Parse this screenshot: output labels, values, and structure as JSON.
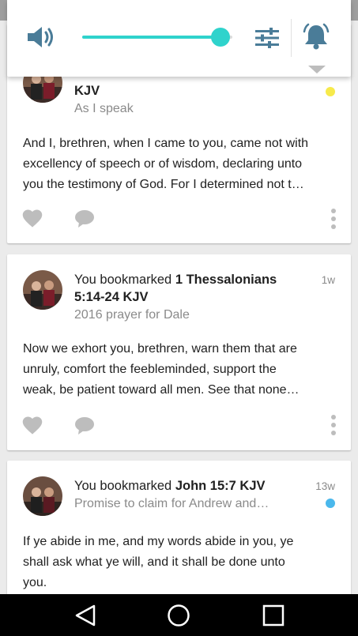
{
  "colors": {
    "accent": "#2fd3cc",
    "unread_yellow": "#f7ea4b",
    "unread_blue": "#4ab8ec",
    "icon_gray": "#bdbdbd",
    "popup_icon": "#4a7c98"
  },
  "volume_popup": {
    "volume_icon": "speaker-icon",
    "level": 0.92,
    "settings_icon": "equalizer-icon",
    "alert_icon": "bell-icon",
    "expand_icon": "chevron-down-icon"
  },
  "feed": [
    {
      "reference": "KJV",
      "note": "As I speak",
      "unread_color": "yellow",
      "body_lines": [
        "And I, brethren, when I came to you, came not with",
        "excellency of speech or of wisdom, declaring unto",
        "you the testimony of God.  For I determined not t…"
      ]
    },
    {
      "prefix": "You bookmarked ",
      "reference_line1": "1 Thessalonians",
      "reference_line2": "5:14-24 KJV",
      "time": "1w",
      "note": "2016 prayer for Dale",
      "body_lines": [
        "Now we exhort you, brethren, warn them that are",
        "unruly, comfort the feebleminded, support the",
        "weak, be patient toward all men.  See that none…"
      ]
    },
    {
      "prefix": "You bookmarked ",
      "reference": "John 15:7 KJV",
      "time": "13w",
      "note": "Promise to claim for Andrew and…",
      "unread_color": "blue",
      "body_lines": [
        "If ye abide in me, and my words abide in you, ye",
        "shall ask what ye will, and it shall be done unto",
        "you."
      ]
    }
  ],
  "actions": {
    "like_icon": "heart-icon",
    "comment_icon": "comment-icon",
    "more_icon": "more-vert-icon"
  },
  "navbar": {
    "back_icon": "back-triangle-icon",
    "home_icon": "home-circle-icon",
    "recents_icon": "recents-square-icon"
  }
}
